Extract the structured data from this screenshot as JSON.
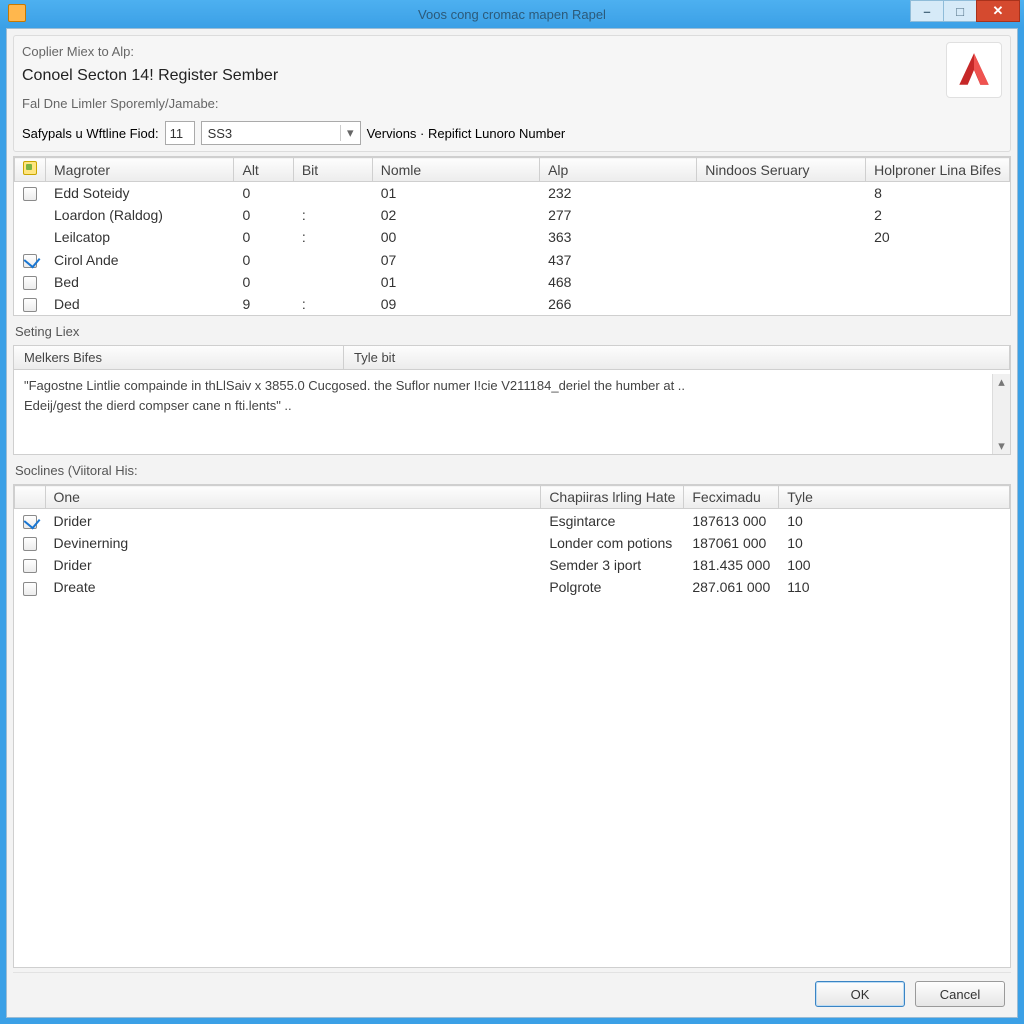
{
  "window": {
    "title": "Voos cong cromac mapen Rapel"
  },
  "header": {
    "line1_label": "Coplier Miex to Alp:",
    "line1_value": "Conoel Secton 14! Register Sember",
    "line2_label": "Fal Dne Limler Sporemly/Jamabe:"
  },
  "controls": {
    "row_label": "Safypals u Wftline Fiod:",
    "spin_value": "11",
    "combo_value": "SS3",
    "trail_label": "Vervions · Repifict Lunoro Number"
  },
  "table1": {
    "columns": [
      "Magroter",
      "Alt",
      "Bit",
      "Nomle",
      "Alp",
      "Nindoos Seruary",
      "Holproner Lina Bifes"
    ],
    "rows": [
      {
        "check": false,
        "c0": "Edd Soteidy",
        "c1": "0",
        "c2": "",
        "c3": "01",
        "c4": "232",
        "c5": "",
        "c6": "8"
      },
      {
        "check": null,
        "c0": "Loardon (Raldog)",
        "c1": "0",
        "c2": ":",
        "c3": "02",
        "c4": "277",
        "c5": "",
        "c6": "2"
      },
      {
        "check": null,
        "c0": "Leilcatop",
        "c1": "0",
        "c2": ":",
        "c3": "00",
        "c4": "363",
        "c5": "",
        "c6": "20"
      },
      {
        "check": true,
        "c0": "Cirol Ande",
        "c1": "0",
        "c2": "",
        "c3": "07",
        "c4": "437",
        "c5": "",
        "c6": ""
      },
      {
        "check": false,
        "c0": "Bed",
        "c1": "0",
        "c2": "",
        "c3": "01",
        "c4": "468",
        "c5": "",
        "c6": ""
      },
      {
        "check": false,
        "c0": "Ded",
        "c1": "9",
        "c2": ":",
        "c3": "09",
        "c4": "266",
        "c5": "",
        "c6": ""
      }
    ]
  },
  "section2_label": "Seting Liex",
  "msg": {
    "h1": "Melkers Bifes",
    "h2": "Tyle bit",
    "line1": "\"Fagostne Lintlie compainde in thLlSaiv x 3855.0 Cucgosed. the Suflor numer I!cie V211184_deriel the humber at   ..",
    "line2": "Edeij/gest the dierd compser cane n fti.lents\"  .."
  },
  "section3_label": "Soclines (Viitoral His:",
  "table2": {
    "columns": [
      "One",
      "Chapiiras lrling Hate",
      "Fecximadu",
      "Tyle"
    ],
    "rows": [
      {
        "check": true,
        "c0": "Drider",
        "c1": "Esgintarce",
        "c2": "187613 000",
        "c3": "10"
      },
      {
        "check": false,
        "c0": "Devinerning",
        "c1": "Londer com potions",
        "c2": "187061 000",
        "c3": "10"
      },
      {
        "check": false,
        "c0": "Drider",
        "c1": "Semder 3 iport",
        "c2": "181.435 000",
        "c3": "100"
      },
      {
        "check": false,
        "c0": "Dreate",
        "c1": "Polgrote",
        "c2": "287.061 000",
        "c3": "110"
      }
    ]
  },
  "buttons": {
    "ok": "OK",
    "cancel": "Cancel"
  }
}
